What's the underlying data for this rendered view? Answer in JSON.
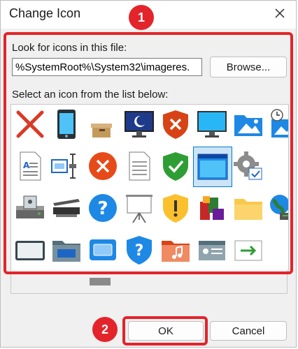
{
  "dialog": {
    "title": "Change Icon"
  },
  "annotations": [
    {
      "number": "1"
    },
    {
      "number": "2"
    }
  ],
  "file": {
    "label": "Look for icons in this file:",
    "path": "%SystemRoot%\\System32\\imageres.",
    "browse_label": "Browse..."
  },
  "list": {
    "label": "Select an icon from the list below:"
  },
  "icons": [
    [
      "x-mark-icon",
      "phone-icon",
      "box-icon",
      "monitor-moon-icon",
      "shield-x-icon",
      "monitor-icon",
      "picture-folder-icon",
      "clock-picture-icon"
    ],
    [
      "text-document-icon",
      "resize-icon",
      "error-x-icon",
      "blank-document-icon",
      "shield-check-icon",
      "window-selected-icon",
      "gear-check-icon"
    ],
    [
      "drive-icon",
      "scanner-icon",
      "question-icon",
      "projector-icon",
      "shield-warning-icon",
      "apps-icon",
      "folder-icon",
      "network-globe-icon"
    ],
    [
      "tablet-icon",
      "drive-folder-icon",
      "display-icon",
      "shield-question-icon",
      "music-folder-icon",
      "contact-card-icon",
      "arrow-right-icon"
    ]
  ],
  "buttons": {
    "ok": "OK",
    "cancel": "Cancel"
  },
  "colors": {
    "annotation": "#e3242b",
    "selection": "#0078d4"
  }
}
